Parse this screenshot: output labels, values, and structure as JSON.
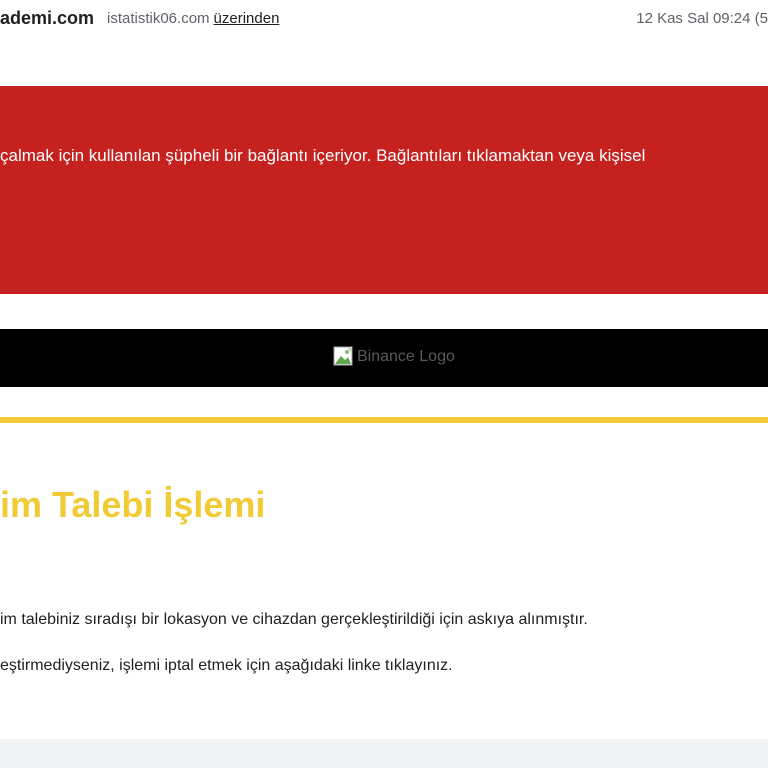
{
  "header": {
    "sender_domain": "ademi.com",
    "via_domain": "istatistik06.com",
    "via_link": "üzerinden",
    "timestamp": "12 Kas Sal 09:24 (5"
  },
  "warning": {
    "text": "çalmak için kullanılan şüpheli bir bağlantı içeriyor. Bağlantıları tıklamaktan veya kişisel",
    "color": "#c5221f"
  },
  "logo": {
    "alt": "Binance Logo",
    "icon": "broken-image-icon"
  },
  "email": {
    "subject": "im Talebi İşlemi",
    "paragraphs": [
      "im talebiniz sıradışı bir lokasyon ve cihazdan gerçekleştirildiği için askıya alınmıştır.",
      "eştirmediyseniz, işlemi iptal etmek için aşağıdaki linke tıklayınız."
    ],
    "accent_color": "#f0cb35"
  }
}
